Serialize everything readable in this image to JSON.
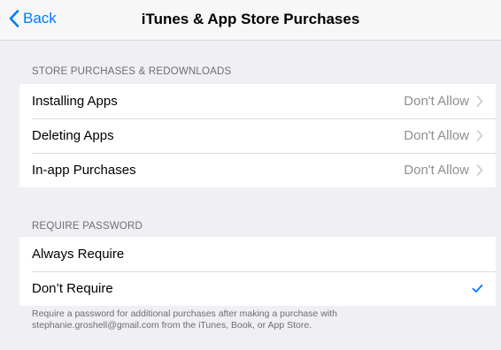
{
  "nav": {
    "back_label": "Back",
    "title": "iTunes & App Store Purchases"
  },
  "section1": {
    "header": "STORE PURCHASES & REDOWNLOADS",
    "rows": [
      {
        "label": "Installing Apps",
        "value": "Don't Allow"
      },
      {
        "label": "Deleting Apps",
        "value": "Don't Allow"
      },
      {
        "label": "In-app Purchases",
        "value": "Don't Allow"
      }
    ]
  },
  "section2": {
    "header": "REQUIRE PASSWORD",
    "rows": [
      {
        "label": "Always Require",
        "selected": false
      },
      {
        "label": "Don’t Require",
        "selected": true
      }
    ],
    "footer_line1": "Require a password for additional purchases after making a purchase with",
    "footer_line2": "stephanie.groshell@gmail.com from the iTunes, Book, or App Store."
  },
  "colors": {
    "accent": "#007aff",
    "background": "#efeff4",
    "secondary_text": "#8e8e93"
  }
}
